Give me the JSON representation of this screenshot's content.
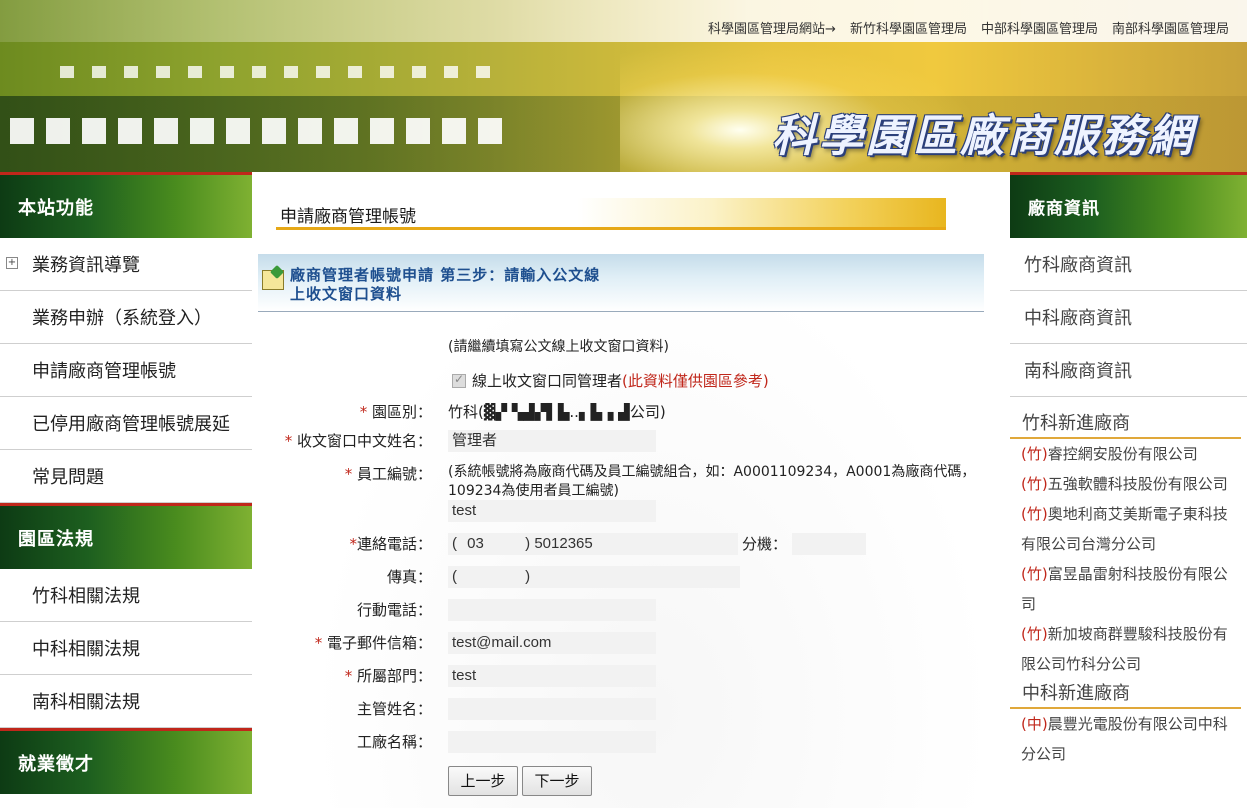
{
  "header": {
    "title": "科學園區廠商服務網",
    "links": [
      "科學園區管理局網站→",
      "新竹科學園區管理局",
      "中部科學園區管理局",
      "南部科學園區管理局"
    ]
  },
  "left": {
    "sections": [
      {
        "title": "本站功能",
        "items": [
          "業務資訊導覽",
          "業務申辦（系統登入）",
          "申請廠商管理帳號",
          "已停用廠商管理帳號展延",
          "常見問題"
        ]
      },
      {
        "title": "園區法規",
        "items": [
          "竹科相關法規",
          "中科相關法規",
          "南科相關法規"
        ]
      },
      {
        "title": "就業徵才",
        "items": []
      }
    ],
    "expand_icon": "plus-box-icon"
  },
  "main": {
    "page_title": "申請廠商管理帳號",
    "panel_title": "廠商管理者帳號申請 第三步：請輸入公文線上收文窗口資料",
    "panel_icon": "edit-note-icon",
    "intro": "(請繼續填寫公文線上收文窗口資料)",
    "same_as_manager_label": "線上收文窗口同管理者",
    "same_as_manager_note": "(此資料僅供園區參考)",
    "same_as_manager_checked": true,
    "fields": {
      "park": {
        "label": "園區別：",
        "required": "*",
        "value": "竹科(▓▞ ▚▟▞▌▙..▖▙▗ ▟公司)"
      },
      "name": {
        "label": "收文窗口中文姓名：",
        "required": "*",
        "value": "管理者"
      },
      "employee_id": {
        "label": "員工編號：",
        "required": "*",
        "hint": "(系統帳號將為廠商代碼及員工編號組合，如：A0001109234，A0001為廠商代碼，109234為使用者員工編號)",
        "value": "test"
      },
      "phone": {
        "label": "連絡電話：",
        "required": "*",
        "area_code": "03",
        "number": "5012365",
        "ext_label": "分機：",
        "ext": ""
      },
      "fax": {
        "label": "傳真：",
        "area_code": "",
        "number": ""
      },
      "mobile": {
        "label": "行動電話：",
        "value": ""
      },
      "email": {
        "label": "電子郵件信箱：",
        "required": "*",
        "value": "test@mail.com"
      },
      "department": {
        "label": "所屬部門：",
        "required": "*",
        "value": "test"
      },
      "supervisor": {
        "label": "主管姓名：",
        "value": ""
      },
      "factory": {
        "label": "工廠名稱：",
        "value": ""
      }
    },
    "buttons": {
      "prev": "上一步",
      "next": "下一步"
    }
  },
  "right": {
    "title": "廠商資訊",
    "items": [
      "竹科廠商資訊",
      "中科廠商資訊",
      "南科廠商資訊"
    ],
    "new_hsinchu": {
      "title": "竹科新進廠商",
      "list": [
        {
          "tag": "(竹)",
          "name": "睿控網安股份有限公司"
        },
        {
          "tag": "(竹)",
          "name": "五強軟體科技股份有限公司"
        },
        {
          "tag": "(竹)",
          "name": "奧地利商艾美斯電子東科技有限公司台灣分公司"
        },
        {
          "tag": "(竹)",
          "name": "富昱晶雷射科技股份有限公司"
        },
        {
          "tag": "(竹)",
          "name": "新加坡商群豐駿科技股份有限公司竹科分公司"
        }
      ]
    },
    "new_central": {
      "title": "中科新進廠商",
      "list": [
        {
          "tag": "(中)",
          "name": "晨豐光電股份有限公司中科分公司"
        }
      ]
    }
  }
}
